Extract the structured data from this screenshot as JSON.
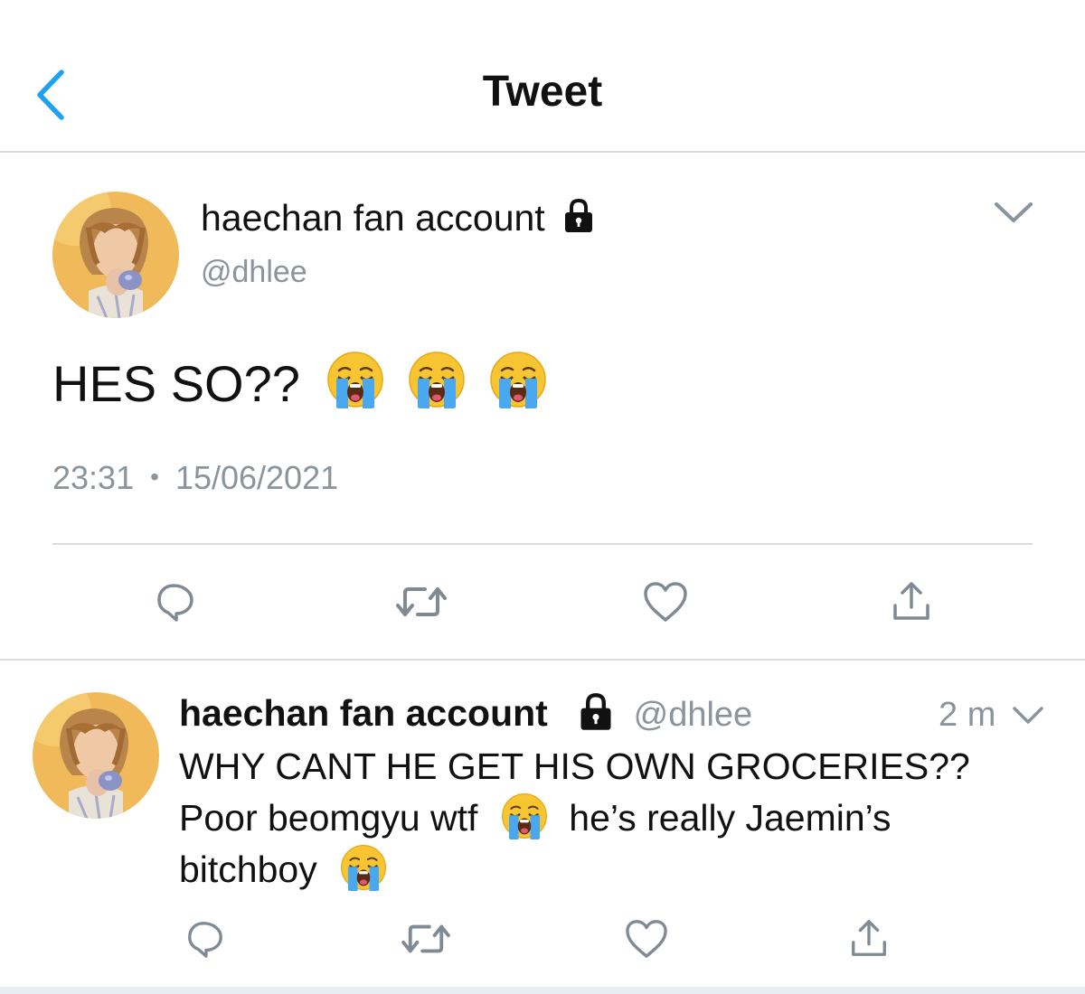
{
  "nav": {
    "title": "Tweet",
    "back_icon": "chevron-left-icon"
  },
  "colors": {
    "accent": "#1da1f2",
    "secondary_text": "#8a949c",
    "icon_gray": "#7f8a94"
  },
  "main_tweet": {
    "display_name": "haechan fan account",
    "handle": "@dhlee",
    "text": "HES SO??",
    "emojis": [
      "loudly-crying-face",
      "loudly-crying-face",
      "loudly-crying-face"
    ],
    "time": "23:31",
    "separator": "•",
    "date": "15/06/2021",
    "actions": [
      "reply-icon",
      "retweet-icon",
      "like-icon",
      "share-icon"
    ]
  },
  "reply_tweet": {
    "display_name": "haechan fan account",
    "handle": "@dhlee",
    "time_ago": "2 m",
    "line1": "WHY CANT HE GET HIS OWN GROCERIES??",
    "line2a": "Poor beomgyu wtf",
    "line2b": "he’s really Jaemin’s",
    "line3": "bitchboy",
    "actions": [
      "reply-icon",
      "retweet-icon",
      "like-icon",
      "share-icon"
    ]
  }
}
